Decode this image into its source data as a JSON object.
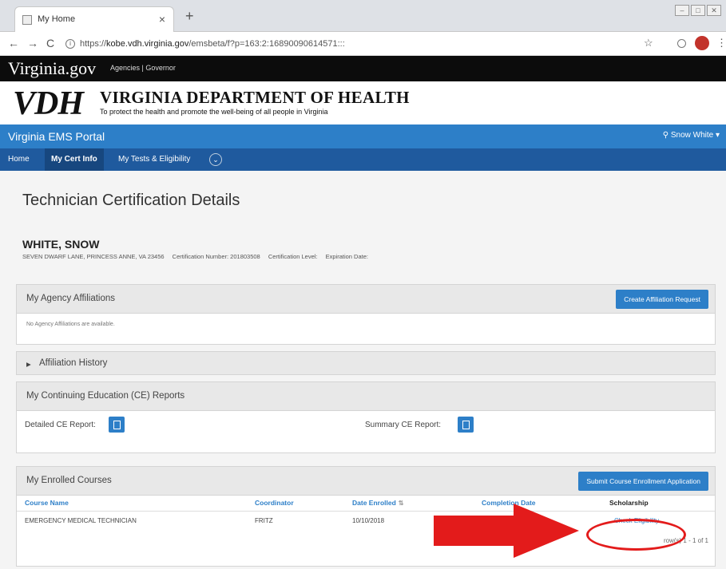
{
  "browser": {
    "tab_title": "My Home",
    "tab_close": "×",
    "new_tab": "+",
    "url_prefix": "https://",
    "url_host": "kobe.vdh.virginia.gov",
    "url_path": "/emsbeta/f?p=163:2:16890090614571:::"
  },
  "vagov": {
    "logo": "Virginia.gov",
    "links": "Agencies | Governor"
  },
  "vdh": {
    "logo": "VDH",
    "name": "VIRGINIA DEPARTMENT OF HEALTH",
    "tagline": "To protect the health and promote the well-being of all people in Virginia"
  },
  "portal": {
    "title": "Virginia EMS Portal",
    "user": "Snow White ▾"
  },
  "nav": {
    "items": [
      "Home",
      "My Cert Info",
      "My Tests & Eligibility"
    ],
    "active": "My Cert Info"
  },
  "page": {
    "title": "Technician Certification Details",
    "person_name": "WHITE, SNOW",
    "address": "SEVEN DWARF LANE, PRINCESS ANNE, VA 23456",
    "cert_number": "Certification Number: 201803508",
    "cert_level": "Certification Level:",
    "expiration": "Expiration Date:"
  },
  "affiliations": {
    "title": "My Agency Affiliations",
    "button": "Create Affiliation Request",
    "empty": "No Agency Affiliations are available."
  },
  "history": {
    "title": "Affiliation History"
  },
  "ce_reports": {
    "title": "My Continuing Education (CE) Reports",
    "detailed_label": "Detailed CE Report:",
    "summary_label": "Summary CE Report:"
  },
  "courses": {
    "title": "My Enrolled Courses",
    "button": "Submit Course Enrollment Application",
    "columns": [
      "Course Name",
      "Coordinator",
      "Date Enrolled",
      "Completion Date",
      "Scholarship"
    ],
    "rows": [
      {
        "course": "EMERGENCY MEDICAL TECHNICIAN",
        "coordinator": "FRITZ",
        "date_enrolled": "10/10/2018",
        "completion": "",
        "scholarship": "Check Eligibility"
      }
    ],
    "row_count": "row(s) 1 - 1 of 1"
  },
  "colors": {
    "primary": "#2d7fc8",
    "nav": "#1f5a9e",
    "annotation": "#e31b1b"
  }
}
